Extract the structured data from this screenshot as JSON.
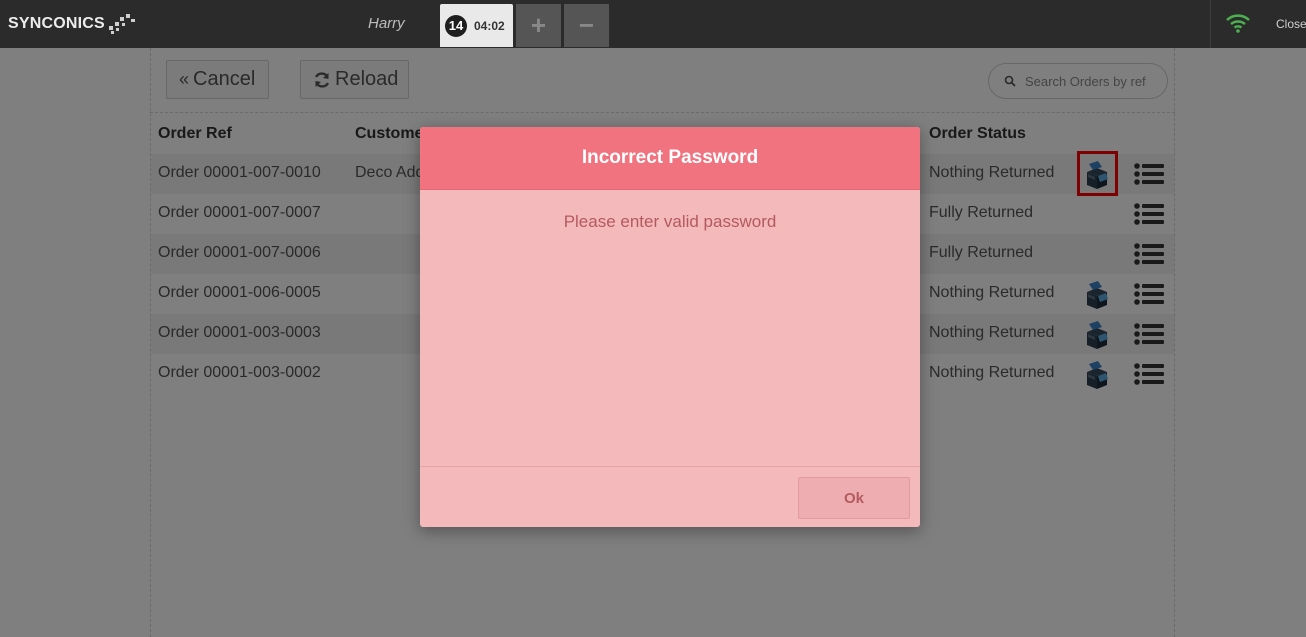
{
  "app": {
    "logo_text": "SYNCONICS",
    "user_name": "Harry",
    "tab_number": "14",
    "tab_time": "04:02",
    "add_label": "+",
    "remove_label": "−",
    "close_label": "Close"
  },
  "toolbar": {
    "cancel_label": "Cancel",
    "reload_label": "Reload",
    "search_placeholder": "Search Orders by ref"
  },
  "table": {
    "headers": {
      "order_ref": "Order Ref",
      "customer": "Custome",
      "order_status": "Order Status"
    },
    "rows": [
      {
        "ref": "Order 00001-007-0010",
        "customer": "Deco Add",
        "status": "Nothing Returned"
      },
      {
        "ref": "Order 00001-007-0007",
        "customer": "",
        "status": "Fully Returned"
      },
      {
        "ref": "Order 00001-007-0006",
        "customer": "",
        "status": "Fully Returned"
      },
      {
        "ref": "Order 00001-006-0005",
        "customer": "",
        "status": "Nothing Returned"
      },
      {
        "ref": "Order 00001-003-0003",
        "customer": "",
        "status": "Nothing Returned"
      },
      {
        "ref": "Order 00001-003-0002",
        "customer": "",
        "status": "Nothing Returned"
      }
    ]
  },
  "modal": {
    "title": "Incorrect Password",
    "message": "Please enter valid password",
    "ok_label": "Ok"
  },
  "colors": {
    "modal_header": "#f0737f",
    "modal_body": "#f4b9bb",
    "highlight": "#ff0000",
    "wifi": "#4caf50"
  }
}
